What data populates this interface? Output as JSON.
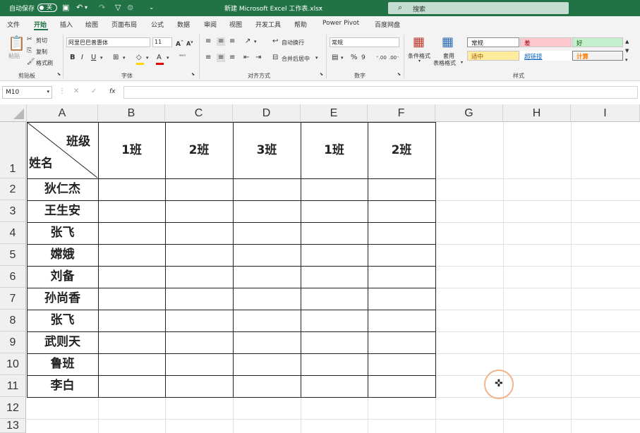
{
  "titlebar": {
    "autosave_label": "自动保存",
    "autosave_state": "关",
    "title": "新建 Microsoft Excel 工作表.xlsx",
    "title_caret": "⌄",
    "search_icon": "⌕",
    "search_placeholder": "搜索"
  },
  "tabs": [
    "文件",
    "开始",
    "插入",
    "绘图",
    "页面布局",
    "公式",
    "数据",
    "审阅",
    "视图",
    "开发工具",
    "帮助",
    "Power Pivot",
    "百度网盘"
  ],
  "ribbon": {
    "clipboard": {
      "paste": "粘贴",
      "cut": "剪切",
      "copy": "复制",
      "format_painter": "格式刷",
      "group": "剪贴板"
    },
    "font": {
      "name": "阿里巴巴普惠体",
      "size": "11",
      "group": "字体"
    },
    "alignment": {
      "wrap": "自动换行",
      "merge": "合并后居中",
      "group": "对齐方式"
    },
    "number": {
      "format": "常规",
      "group": "数字"
    },
    "styles": {
      "conditional_line1": "条件格式",
      "table_line1": "套用",
      "table_line2": "表格格式",
      "s_normal": "常规",
      "s_bad": "差",
      "s_good": "好",
      "s_neutral": "适中",
      "s_link": "超链接",
      "s_calc": "计算",
      "group": "样式"
    }
  },
  "formula_bar": {
    "name_box": "M10",
    "fx": "fx",
    "value": ""
  },
  "sheet": {
    "columns": [
      "A",
      "B",
      "C",
      "D",
      "E",
      "F",
      "G",
      "H",
      "I"
    ],
    "rows": [
      "1",
      "2",
      "3",
      "4",
      "5",
      "6",
      "7",
      "8",
      "9",
      "10",
      "11",
      "12",
      "13"
    ],
    "header_top_right": "班级",
    "header_bottom_left": "姓名",
    "classes": [
      "1班",
      "2班",
      "3班",
      "1班",
      "2班"
    ],
    "names": [
      "狄仁杰",
      "王生安",
      "张飞",
      "嫦娥",
      "刘备",
      "孙尚香",
      "张飞",
      "武则天",
      "鲁班",
      "李白"
    ]
  },
  "accent_color": "#217346"
}
